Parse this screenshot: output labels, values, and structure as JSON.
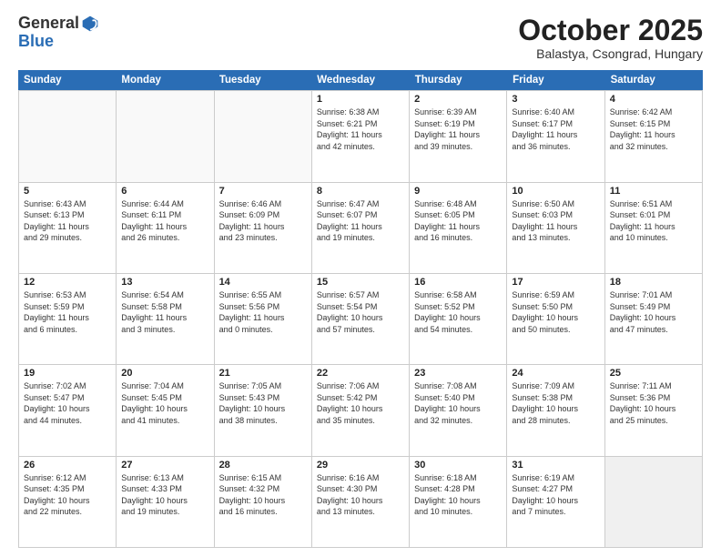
{
  "logo": {
    "general": "General",
    "blue": "Blue"
  },
  "header": {
    "month": "October 2025",
    "location": "Balastya, Csongrad, Hungary"
  },
  "days": [
    "Sunday",
    "Monday",
    "Tuesday",
    "Wednesday",
    "Thursday",
    "Friday",
    "Saturday"
  ],
  "weeks": [
    [
      {
        "day": "",
        "content": ""
      },
      {
        "day": "",
        "content": ""
      },
      {
        "day": "",
        "content": ""
      },
      {
        "day": "1",
        "content": "Sunrise: 6:38 AM\nSunset: 6:21 PM\nDaylight: 11 hours\nand 42 minutes."
      },
      {
        "day": "2",
        "content": "Sunrise: 6:39 AM\nSunset: 6:19 PM\nDaylight: 11 hours\nand 39 minutes."
      },
      {
        "day": "3",
        "content": "Sunrise: 6:40 AM\nSunset: 6:17 PM\nDaylight: 11 hours\nand 36 minutes."
      },
      {
        "day": "4",
        "content": "Sunrise: 6:42 AM\nSunset: 6:15 PM\nDaylight: 11 hours\nand 32 minutes."
      }
    ],
    [
      {
        "day": "5",
        "content": "Sunrise: 6:43 AM\nSunset: 6:13 PM\nDaylight: 11 hours\nand 29 minutes."
      },
      {
        "day": "6",
        "content": "Sunrise: 6:44 AM\nSunset: 6:11 PM\nDaylight: 11 hours\nand 26 minutes."
      },
      {
        "day": "7",
        "content": "Sunrise: 6:46 AM\nSunset: 6:09 PM\nDaylight: 11 hours\nand 23 minutes."
      },
      {
        "day": "8",
        "content": "Sunrise: 6:47 AM\nSunset: 6:07 PM\nDaylight: 11 hours\nand 19 minutes."
      },
      {
        "day": "9",
        "content": "Sunrise: 6:48 AM\nSunset: 6:05 PM\nDaylight: 11 hours\nand 16 minutes."
      },
      {
        "day": "10",
        "content": "Sunrise: 6:50 AM\nSunset: 6:03 PM\nDaylight: 11 hours\nand 13 minutes."
      },
      {
        "day": "11",
        "content": "Sunrise: 6:51 AM\nSunset: 6:01 PM\nDaylight: 11 hours\nand 10 minutes."
      }
    ],
    [
      {
        "day": "12",
        "content": "Sunrise: 6:53 AM\nSunset: 5:59 PM\nDaylight: 11 hours\nand 6 minutes."
      },
      {
        "day": "13",
        "content": "Sunrise: 6:54 AM\nSunset: 5:58 PM\nDaylight: 11 hours\nand 3 minutes."
      },
      {
        "day": "14",
        "content": "Sunrise: 6:55 AM\nSunset: 5:56 PM\nDaylight: 11 hours\nand 0 minutes."
      },
      {
        "day": "15",
        "content": "Sunrise: 6:57 AM\nSunset: 5:54 PM\nDaylight: 10 hours\nand 57 minutes."
      },
      {
        "day": "16",
        "content": "Sunrise: 6:58 AM\nSunset: 5:52 PM\nDaylight: 10 hours\nand 54 minutes."
      },
      {
        "day": "17",
        "content": "Sunrise: 6:59 AM\nSunset: 5:50 PM\nDaylight: 10 hours\nand 50 minutes."
      },
      {
        "day": "18",
        "content": "Sunrise: 7:01 AM\nSunset: 5:49 PM\nDaylight: 10 hours\nand 47 minutes."
      }
    ],
    [
      {
        "day": "19",
        "content": "Sunrise: 7:02 AM\nSunset: 5:47 PM\nDaylight: 10 hours\nand 44 minutes."
      },
      {
        "day": "20",
        "content": "Sunrise: 7:04 AM\nSunset: 5:45 PM\nDaylight: 10 hours\nand 41 minutes."
      },
      {
        "day": "21",
        "content": "Sunrise: 7:05 AM\nSunset: 5:43 PM\nDaylight: 10 hours\nand 38 minutes."
      },
      {
        "day": "22",
        "content": "Sunrise: 7:06 AM\nSunset: 5:42 PM\nDaylight: 10 hours\nand 35 minutes."
      },
      {
        "day": "23",
        "content": "Sunrise: 7:08 AM\nSunset: 5:40 PM\nDaylight: 10 hours\nand 32 minutes."
      },
      {
        "day": "24",
        "content": "Sunrise: 7:09 AM\nSunset: 5:38 PM\nDaylight: 10 hours\nand 28 minutes."
      },
      {
        "day": "25",
        "content": "Sunrise: 7:11 AM\nSunset: 5:36 PM\nDaylight: 10 hours\nand 25 minutes."
      }
    ],
    [
      {
        "day": "26",
        "content": "Sunrise: 6:12 AM\nSunset: 4:35 PM\nDaylight: 10 hours\nand 22 minutes."
      },
      {
        "day": "27",
        "content": "Sunrise: 6:13 AM\nSunset: 4:33 PM\nDaylight: 10 hours\nand 19 minutes."
      },
      {
        "day": "28",
        "content": "Sunrise: 6:15 AM\nSunset: 4:32 PM\nDaylight: 10 hours\nand 16 minutes."
      },
      {
        "day": "29",
        "content": "Sunrise: 6:16 AM\nSunset: 4:30 PM\nDaylight: 10 hours\nand 13 minutes."
      },
      {
        "day": "30",
        "content": "Sunrise: 6:18 AM\nSunset: 4:28 PM\nDaylight: 10 hours\nand 10 minutes."
      },
      {
        "day": "31",
        "content": "Sunrise: 6:19 AM\nSunset: 4:27 PM\nDaylight: 10 hours\nand 7 minutes."
      },
      {
        "day": "",
        "content": ""
      }
    ]
  ]
}
